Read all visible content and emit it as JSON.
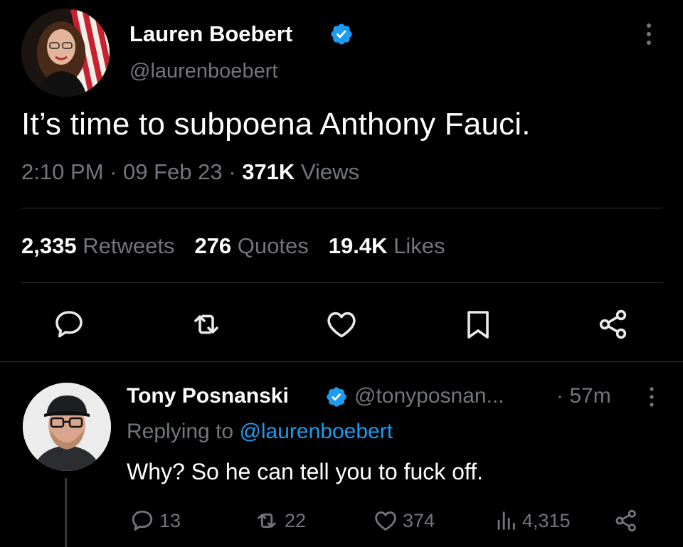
{
  "tweet": {
    "author_name": "Lauren Boebert",
    "author_handle": "@laurenboebert",
    "text": "It’s time to subpoena Anthony Fauci.",
    "time": "2:10 PM",
    "date": "09 Feb 23",
    "views_count": "371K",
    "views_label": "Views",
    "retweets_count": "2,335",
    "retweets_label": "Retweets",
    "quotes_count": "276",
    "quotes_label": "Quotes",
    "likes_count": "19.4K",
    "likes_label": "Likes",
    "actions": [
      "reply-icon",
      "retweet-icon",
      "like-icon",
      "bookmark-icon",
      "share-icon"
    ]
  },
  "reply": {
    "author_name": "Tony Posnanski",
    "author_handle": "@tonyposnan...",
    "time": "· 57m",
    "replying_prefix": "Replying to",
    "replying_to": "@laurenboebert",
    "text": "Why? So he can tell you to fuck off.",
    "reply_count": "13",
    "retweet_count": "22",
    "like_count": "374",
    "views_count": "4,315"
  },
  "colors": {
    "background": "#000000",
    "text": "#e7e9ea",
    "secondary": "#71767b",
    "accent": "#1d9bf0",
    "divider": "#2f3336"
  }
}
